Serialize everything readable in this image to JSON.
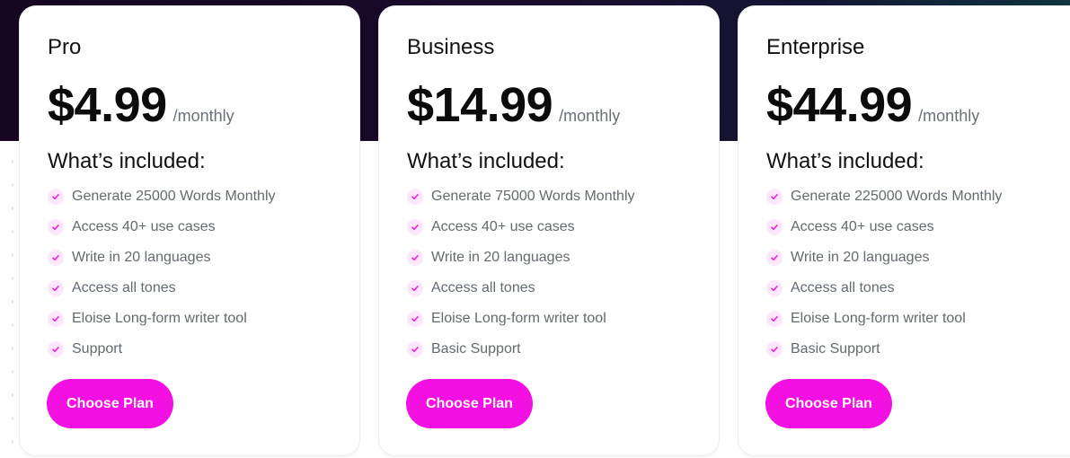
{
  "colors": {
    "accent": "#f40fe3",
    "check_bg": "#fde7fb",
    "check_icon": "#ee18dd",
    "hero_bg": "#1a0a2c"
  },
  "plans": [
    {
      "name": "Pro",
      "price": "$4.99",
      "period": "/monthly",
      "included_heading": "What’s included:",
      "features": [
        "Generate 25000 Words Monthly",
        "Access 40+ use cases",
        "Write in 20 languages",
        "Access all tones",
        "Eloise Long-form writer tool",
        "Support"
      ],
      "button": "Choose Plan"
    },
    {
      "name": "Business",
      "price": "$14.99",
      "period": "/monthly",
      "included_heading": "What’s included:",
      "features": [
        "Generate 75000 Words Monthly",
        "Access 40+ use cases",
        "Write in 20 languages",
        "Access all tones",
        "Eloise Long-form writer tool",
        "Basic Support"
      ],
      "button": "Choose Plan"
    },
    {
      "name": "Enterprise",
      "price": "$44.99",
      "period": "/monthly",
      "included_heading": "What’s included:",
      "features": [
        "Generate 225000 Words Monthly",
        "Access 40+ use cases",
        "Write in 20 languages",
        "Access all tones",
        "Eloise Long-form writer tool",
        "Basic Support"
      ],
      "button": "Choose Plan"
    }
  ],
  "icons": {
    "feature": "check-icon"
  }
}
